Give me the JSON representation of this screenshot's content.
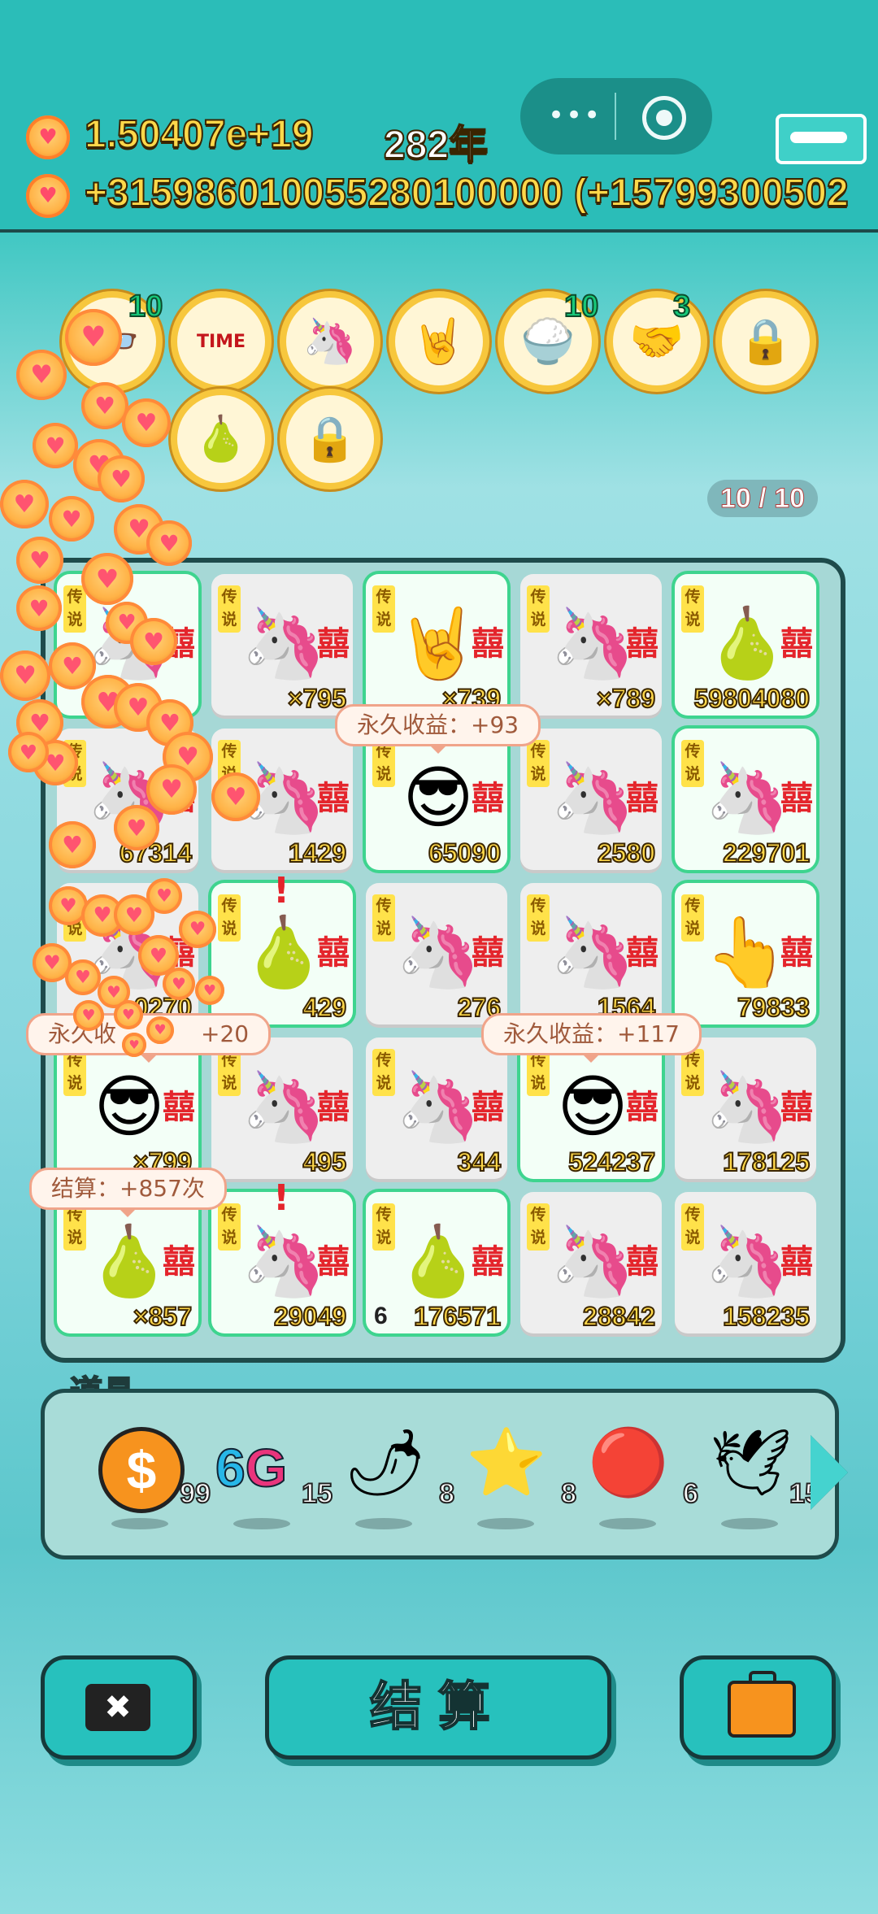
{
  "header": {
    "coins_total": "1.50407e+19",
    "year": "282年",
    "income": "+315986010055280100000 (+15799300502",
    "coin_icon": "heart-coin-icon"
  },
  "buffs": [
    {
      "name": "time-cover-icon",
      "glyph": "👓",
      "count": "10"
    },
    {
      "name": "time-magazine-icon",
      "glyph": "TIME",
      "count": ""
    },
    {
      "name": "unicorn-heart-icon",
      "glyph": "🦄",
      "count": ""
    },
    {
      "name": "rock-hand-icon",
      "glyph": "🤘",
      "count": ""
    },
    {
      "name": "rice-bowl-icon",
      "glyph": "🍚",
      "count": "10"
    },
    {
      "name": "handshake-icon",
      "glyph": "🤝",
      "count": "3"
    },
    {
      "name": "safe-icon",
      "glyph": "🔒",
      "count": ""
    },
    {
      "name": "grapefruit-icon",
      "glyph": "🍐",
      "count": ""
    },
    {
      "name": "safe-icon-2",
      "glyph": "🔒",
      "count": ""
    }
  ],
  "slots": "10 / 10",
  "board": {
    "tag_text": "传说",
    "xi": "囍",
    "cells": [
      {
        "icon": "unicorn",
        "value": "",
        "hl": true
      },
      {
        "icon": "unicorn",
        "value": "×795",
        "hl": false
      },
      {
        "icon": "rock-hand",
        "value": "×739",
        "hl": true
      },
      {
        "icon": "unicorn",
        "value": "×789",
        "hl": false
      },
      {
        "icon": "pomelo",
        "value": "59804080",
        "hl": true
      },
      {
        "icon": "unicorn",
        "value": "67314",
        "hl": false
      },
      {
        "icon": "unicorn",
        "value": "1429",
        "hl": false
      },
      {
        "icon": "sunglasses-man",
        "value": "65090",
        "hl": true
      },
      {
        "icon": "unicorn",
        "value": "2580",
        "hl": false
      },
      {
        "icon": "unicorn",
        "value": "229701",
        "hl": true
      },
      {
        "icon": "unicorn",
        "value": "0270",
        "hl": false
      },
      {
        "icon": "pomelo",
        "value": "429",
        "hl": true
      },
      {
        "icon": "unicorn",
        "value": "276",
        "hl": false
      },
      {
        "icon": "unicorn",
        "value": "1564",
        "hl": false
      },
      {
        "icon": "pointing-hand",
        "value": "79833",
        "hl": true
      },
      {
        "icon": "sunglasses-man",
        "value": "×799",
        "hl": true
      },
      {
        "icon": "unicorn",
        "value": "495",
        "hl": false
      },
      {
        "icon": "unicorn",
        "value": "344",
        "hl": false
      },
      {
        "icon": "sunglasses-man",
        "value": "524237",
        "hl": true
      },
      {
        "icon": "unicorn",
        "value": "178125",
        "hl": false
      },
      {
        "icon": "pomelo",
        "value": "×857",
        "hl": true
      },
      {
        "icon": "unicorn",
        "value": "29049",
        "hl": true
      },
      {
        "icon": "pomelo",
        "value": "176571",
        "level": "6",
        "hl": true
      },
      {
        "icon": "unicorn",
        "value": "28842",
        "hl": false
      },
      {
        "icon": "unicorn",
        "value": "158235",
        "hl": false
      }
    ],
    "bubbles": [
      "永久收益：+93",
      "永久收益：+117",
      "永久收益：+20",
      "结算：+857次"
    ],
    "bubble_b3_left": "永久收",
    "bubble_b3_right": "+20"
  },
  "items": {
    "title": "道具",
    "list": [
      {
        "name": "dollar-coin-icon",
        "count": "99"
      },
      {
        "name": "6g-icon",
        "label": "6G",
        "count": "15"
      },
      {
        "name": "chili-pepper-icon",
        "glyph": "🌶",
        "count": "8"
      },
      {
        "name": "star-icon",
        "glyph": "⭐",
        "count": "8"
      },
      {
        "name": "lychee-icon",
        "glyph": "🔴",
        "count": "6"
      },
      {
        "name": "white-duck-icon",
        "glyph": "🕊",
        "count": "15"
      }
    ]
  },
  "buttons": {
    "cancel": "✖",
    "settle": "结算",
    "bag_icon": "briefcase-icon"
  },
  "colors": {
    "teal": "#2bbdb8",
    "gold": "#ffd84a",
    "green_hl": "#3ed48f"
  }
}
